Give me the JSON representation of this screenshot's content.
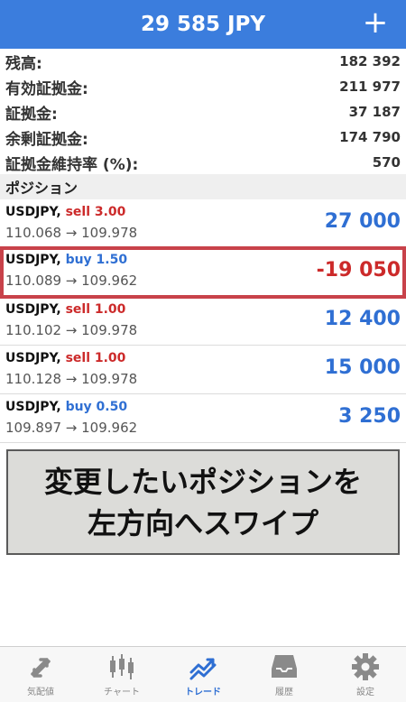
{
  "header": {
    "title": "29 585 JPY",
    "add_label": "+"
  },
  "summary": [
    {
      "label": "残高:",
      "value": "182 392"
    },
    {
      "label": "有効証拠金:",
      "value": "211 977"
    },
    {
      "label": "証拠金:",
      "value": "37 187"
    },
    {
      "label": "余剰証拠金:",
      "value": "174 790"
    },
    {
      "label": "証拠金維持率 (%):",
      "value": "570"
    }
  ],
  "section_title": "ポジション",
  "positions": [
    {
      "symbol": "USDJPY,",
      "side": "sell 3.00",
      "prices": "110.068 → 109.978",
      "profit": "27 000"
    },
    {
      "symbol": "USDJPY,",
      "side": "buy 1.50",
      "prices": "110.089 → 109.962",
      "profit": "-19 050"
    },
    {
      "symbol": "USDJPY,",
      "side": "sell 1.00",
      "prices": "110.102 → 109.978",
      "profit": "12 400"
    },
    {
      "symbol": "USDJPY,",
      "side": "sell 1.00",
      "prices": "110.128 → 109.978",
      "profit": "15 000"
    },
    {
      "symbol": "USDJPY,",
      "side": "buy 0.50",
      "prices": "109.897 → 109.962",
      "profit": "3 250"
    }
  ],
  "note": {
    "line1": "変更したいポジションを",
    "line2": "左方向へスワイプ"
  },
  "tabs": [
    {
      "label": "気配値",
      "icon": "arrows-icon"
    },
    {
      "label": "チャート",
      "icon": "candles-icon"
    },
    {
      "label": "トレード",
      "icon": "trend-icon"
    },
    {
      "label": "履歴",
      "icon": "inbox-icon"
    },
    {
      "label": "設定",
      "icon": "gear-icon"
    }
  ],
  "colors": {
    "accent": "#3b7ddd",
    "buy": "#2f6fd3",
    "sell": "#cc2a2a",
    "highlight": "#c8424a"
  }
}
